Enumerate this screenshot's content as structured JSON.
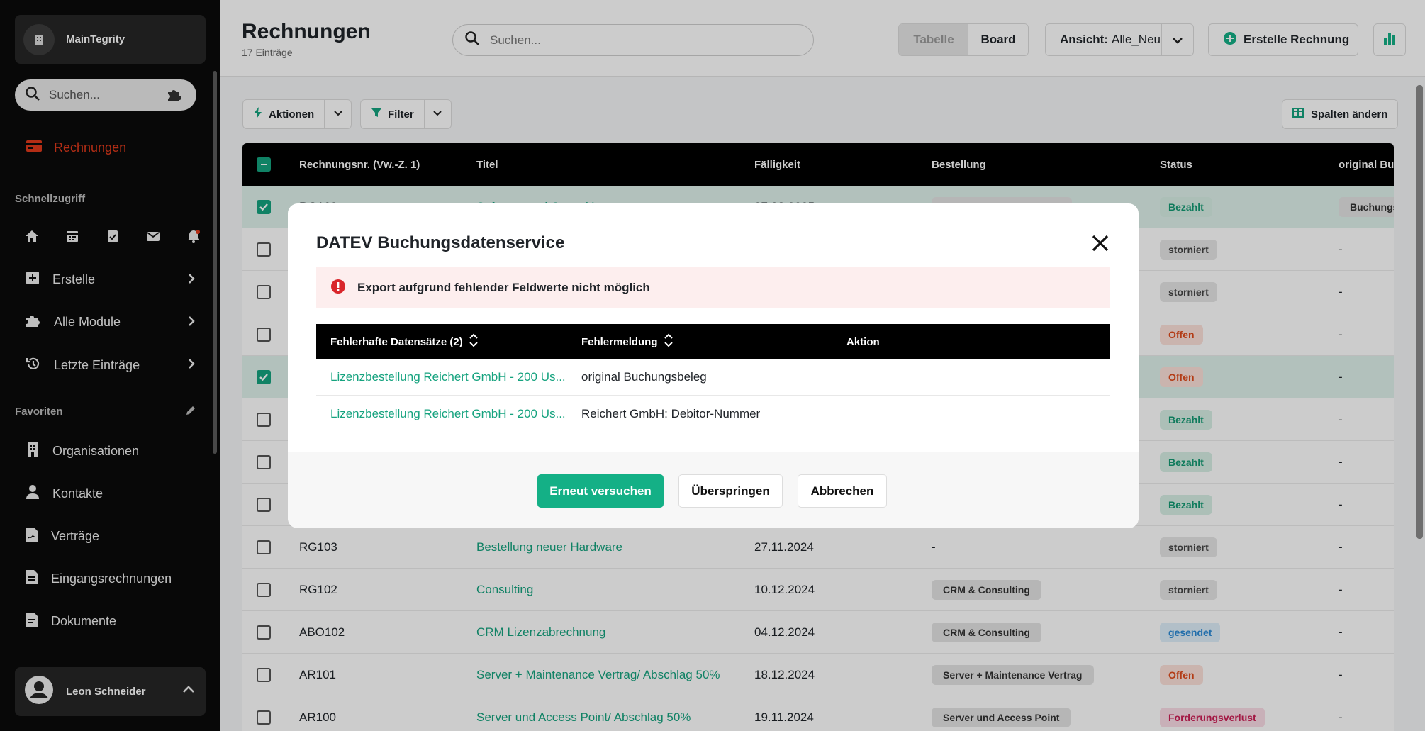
{
  "sidebar": {
    "org_name": "MainTegrity",
    "search_placeholder": "Suchen...",
    "active_item": "Rechnungen",
    "quick_title": "Schnellzugriff",
    "nav": [
      {
        "label": "Erstelle"
      },
      {
        "label": "Alle Module"
      },
      {
        "label": "Letzte Einträge"
      }
    ],
    "favorites_title": "Favoriten",
    "favorites": [
      {
        "label": "Organisationen"
      },
      {
        "label": "Kontakte"
      },
      {
        "label": "Verträge"
      },
      {
        "label": "Eingangsrechnungen"
      },
      {
        "label": "Dokumente"
      }
    ],
    "user_name": "Leon Schneider"
  },
  "header": {
    "title": "Rechnungen",
    "subtitle": "17 Einträge",
    "search_placeholder": "Suchen...",
    "view_table": "Tabelle",
    "view_board": "Board",
    "view_select_label": "Ansicht:",
    "view_select_value": "Alle_Neu",
    "create_label": "Erstelle Rechnung"
  },
  "toolbar": {
    "actions_label": "Aktionen",
    "filter_label": "Filter",
    "columns_label": "Spalten ändern"
  },
  "table": {
    "columns": [
      "Rechnungsnr. (Vw.-Z. 1)",
      "Titel",
      "Fälligkeit",
      "Bestellung",
      "Status",
      "original Buc"
    ],
    "rows": [
      {
        "nr": "RG109",
        "title": "Software und Consulting",
        "due": "27.03.2025",
        "order": "Software und Consulting",
        "status": "Bezahlt",
        "orig": "Buchungs",
        "selected": true
      },
      {
        "nr": "",
        "title": "",
        "due": "",
        "order": "",
        "status": "storniert",
        "orig": "-",
        "selected": false
      },
      {
        "nr": "",
        "title": "",
        "due": "",
        "order": "",
        "status": "storniert",
        "orig": "-",
        "selected": false
      },
      {
        "nr": "",
        "title": "",
        "due": "",
        "order": "",
        "status": "Offen",
        "orig": "-",
        "selected": false
      },
      {
        "nr": "",
        "title": "",
        "due": "",
        "order": "",
        "status": "Offen",
        "orig": "-",
        "selected": true
      },
      {
        "nr": "",
        "title": "",
        "due": "",
        "order": "",
        "status": "Bezahlt",
        "orig": "-",
        "selected": false
      },
      {
        "nr": "",
        "title": "",
        "due": "",
        "order": "",
        "status": "Bezahlt",
        "orig": "-",
        "selected": false
      },
      {
        "nr": "",
        "title": "",
        "due": "",
        "order": "",
        "status": "Bezahlt",
        "orig": "-",
        "selected": false
      },
      {
        "nr": "RG103",
        "title": "Bestellung neuer Hardware",
        "due": "27.11.2024",
        "order": "-",
        "status": "storniert",
        "orig": "-",
        "selected": false
      },
      {
        "nr": "RG102",
        "title": "Consulting",
        "due": "10.12.2024",
        "order": "CRM & Consulting",
        "status": "storniert",
        "orig": "-",
        "selected": false
      },
      {
        "nr": "ABO102",
        "title": "CRM Lizenzabrechnung",
        "due": "04.12.2024",
        "order": "CRM & Consulting",
        "status": "gesendet",
        "orig": "-",
        "selected": false
      },
      {
        "nr": "AR101",
        "title": "Server + Maintenance Vertrag/ Abschlag 50%",
        "due": "18.12.2024",
        "order": "Server + Maintenance Vertrag",
        "status": "Offen",
        "orig": "-",
        "selected": false
      },
      {
        "nr": "AR100",
        "title": "Server und Access Point/ Abschlag 50%",
        "due": "19.11.2024",
        "order": "Server und Access Point",
        "status": "Forderungsverlust",
        "orig": "-",
        "selected": false
      }
    ]
  },
  "modal": {
    "title": "DATEV Buchungsdatenservice",
    "alert": "Export aufgrund fehlender Feldwerte nicht möglich",
    "columns": [
      "Fehlerhafte Datensätze (2)",
      "Fehlermeldung",
      "Aktion"
    ],
    "rows": [
      {
        "record": "Lizenzbestellung Reichert GmbH - 200 Us...",
        "message": "original Buchungsbeleg"
      },
      {
        "record": "Lizenzbestellung Reichert GmbH - 200 Us...",
        "message": "Reichert GmbH: Debitor-Nummer"
      }
    ],
    "buttons": {
      "retry": "Erneut versuchen",
      "skip": "Überspringen",
      "cancel": "Abbrechen"
    }
  },
  "colors": {
    "accent": "#14b086",
    "danger": "#e0391b",
    "sidebar": "#0b0b0b"
  }
}
